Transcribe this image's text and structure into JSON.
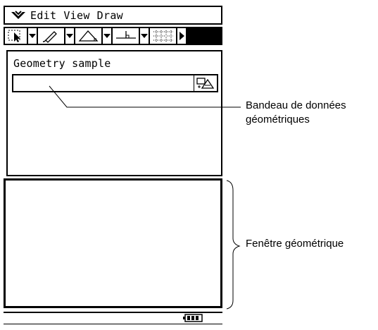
{
  "menubar": {
    "items": [
      "Edit",
      "View",
      "Draw"
    ]
  },
  "panel": {
    "title": "Geometry sample"
  },
  "callouts": {
    "data_bar_line1": "Bandeau de données",
    "data_bar_line2": "géométriques",
    "geometry_window": "Fenêtre géométrique"
  },
  "icons": {
    "menu": "chevron-menu-icon",
    "select": "pointer-select-icon",
    "pen": "pen-icon",
    "triangle": "triangle-icon",
    "perpendicular": "perpendicular-icon",
    "grid": "grid-icon",
    "toolbar_more": "right-arrow-icon",
    "data_bar_button": "measure-icon",
    "battery": "battery-icon"
  }
}
